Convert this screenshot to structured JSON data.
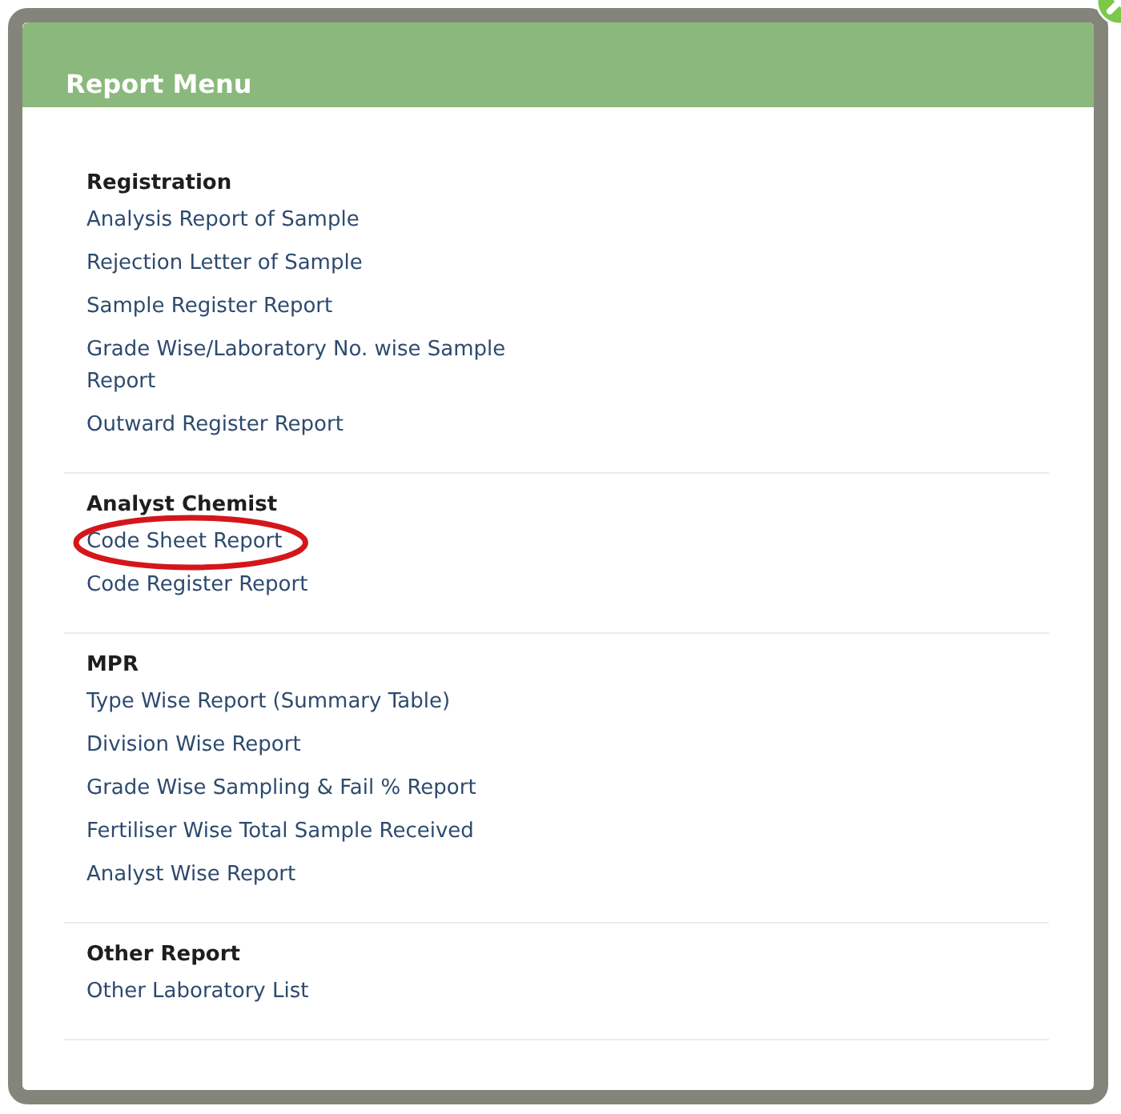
{
  "dialog": {
    "title": "Report Menu"
  },
  "sections": [
    {
      "heading": "Registration",
      "items": [
        {
          "label": "Analysis Report of Sample",
          "highlighted": false
        },
        {
          "label": "Rejection Letter of Sample",
          "highlighted": false
        },
        {
          "label": "Sample Register Report",
          "highlighted": false
        },
        {
          "label": "Grade Wise/Laboratory No. wise Sample Report",
          "highlighted": false
        },
        {
          "label": "Outward Register Report",
          "highlighted": false
        }
      ]
    },
    {
      "heading": "Analyst Chemist",
      "items": [
        {
          "label": "Code Sheet Report",
          "highlighted": true
        },
        {
          "label": "Code Register Report",
          "highlighted": false
        }
      ]
    },
    {
      "heading": "MPR",
      "items": [
        {
          "label": "Type Wise Report (Summary Table)",
          "highlighted": false
        },
        {
          "label": "Division Wise Report",
          "highlighted": false
        },
        {
          "label": "Grade Wise Sampling & Fail % Report",
          "highlighted": false
        },
        {
          "label": "Fertiliser Wise Total Sample Received",
          "highlighted": false
        },
        {
          "label": "Analyst Wise Report",
          "highlighted": false
        }
      ]
    },
    {
      "heading": "Other Report",
      "items": [
        {
          "label": "Other Laboratory List",
          "highlighted": false
        }
      ]
    }
  ]
}
